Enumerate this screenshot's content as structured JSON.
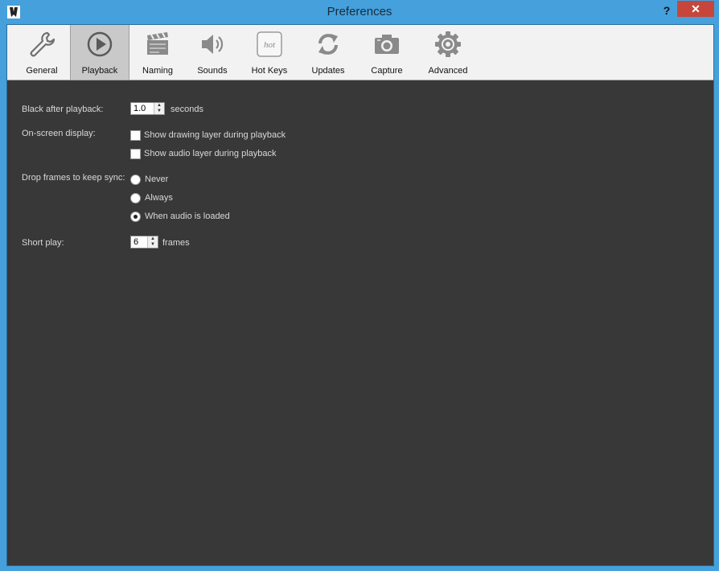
{
  "window": {
    "title": "Preferences",
    "help": "?",
    "close": "✕"
  },
  "tabs": [
    {
      "label": "General",
      "icon": "wrench-icon"
    },
    {
      "label": "Playback",
      "icon": "play-icon",
      "selected": true
    },
    {
      "label": "Naming",
      "icon": "clapperboard-icon"
    },
    {
      "label": "Sounds",
      "icon": "speaker-icon"
    },
    {
      "label": "Hot Keys",
      "icon": "hot-keys-icon"
    },
    {
      "label": "Updates",
      "icon": "refresh-icon"
    },
    {
      "label": "Capture",
      "icon": "camera-icon"
    },
    {
      "label": "Advanced",
      "icon": "gear-icon"
    }
  ],
  "hotkeys_icon_text": "hot",
  "playback": {
    "black_after_label": "Black after playback:",
    "black_after_value": "1.0",
    "black_after_unit": "seconds",
    "osd_label": "On-screen display:",
    "osd_drawing": "Show drawing layer during playback",
    "osd_audio": "Show audio layer during playback",
    "drop_label": "Drop frames to keep sync:",
    "drop_never": "Never",
    "drop_always": "Always",
    "drop_audio": "When audio is loaded",
    "drop_selected": "When audio is loaded",
    "short_label": "Short play:",
    "short_value": "6",
    "short_unit": "frames"
  },
  "colors": {
    "title_bar": "#45a0dc",
    "close_button": "#c7463c",
    "content_bg": "#383838",
    "toolbar_bg": "#f2f2f2"
  }
}
